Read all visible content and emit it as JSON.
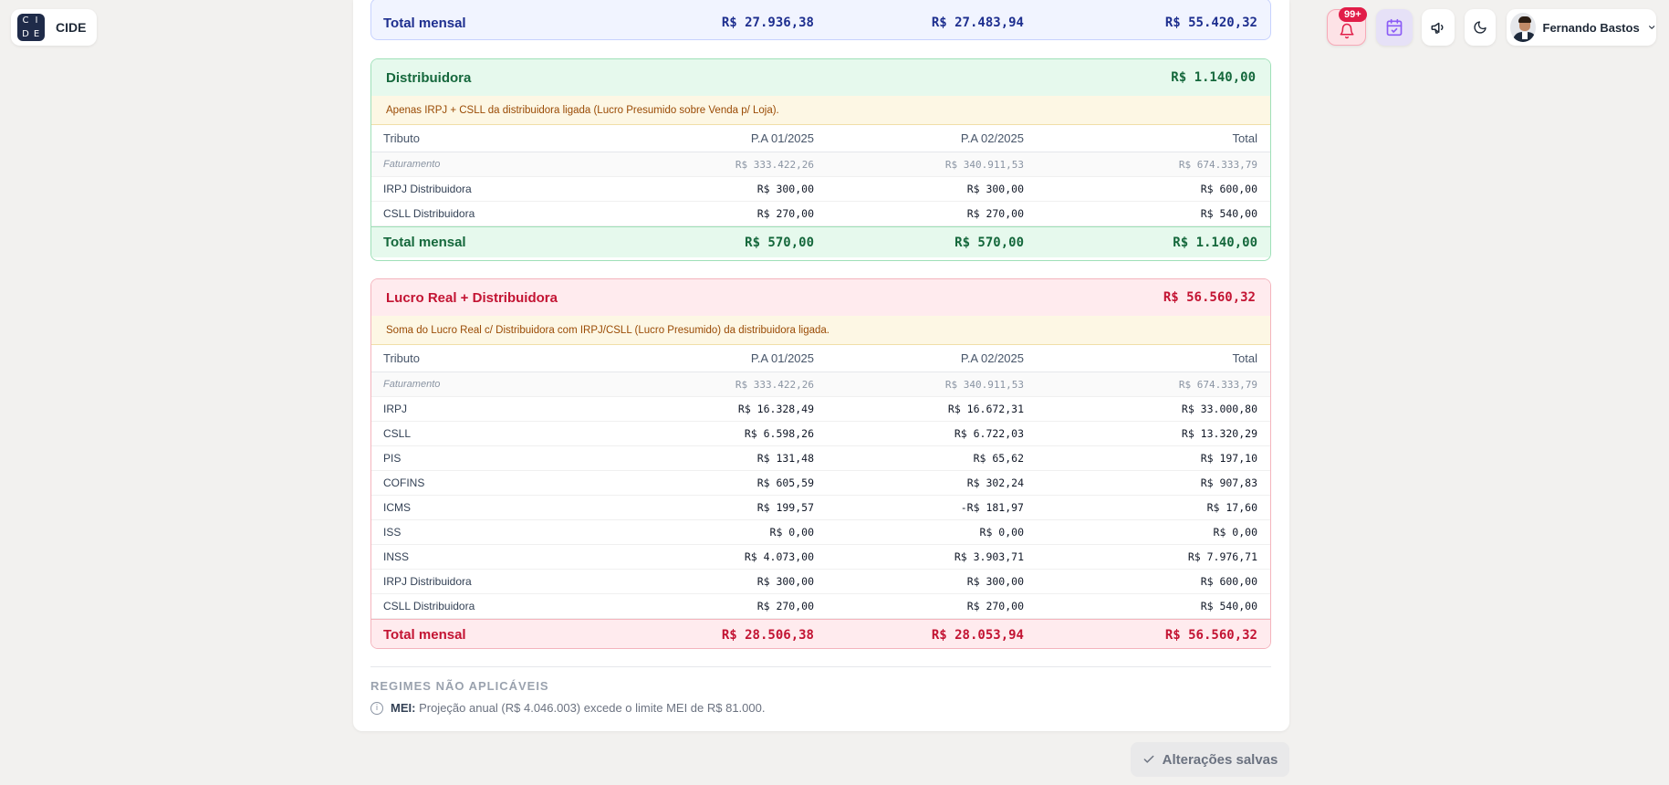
{
  "app": {
    "logo_letters": [
      "C",
      "I",
      "D",
      "E"
    ],
    "name": "CIDE"
  },
  "header": {
    "notifications_badge": "99+",
    "user_name": "Fernando Bastos"
  },
  "columns": {
    "tributo": "Tributo",
    "p1": "P.A 01/2025",
    "p2": "P.A 02/2025",
    "total": "Total"
  },
  "top_total": {
    "label": "Total mensal",
    "p1": "R$ 27.936,38",
    "p2": "R$ 27.483,94",
    "total": "R$ 55.420,32"
  },
  "distribuidora": {
    "title": "Distribuidora",
    "amount": "R$ 1.140,00",
    "note": "Apenas IRPJ + CSLL da distribuidora ligada (Lucro Presumido sobre Venda p/ Loja).",
    "faturamento": {
      "label": "Faturamento",
      "p1": "R$ 333.422,26",
      "p2": "R$ 340.911,53",
      "total": "R$ 674.333,79"
    },
    "rows": [
      {
        "label": "IRPJ Distribuidora",
        "p1": "R$ 300,00",
        "p2": "R$ 300,00",
        "total": "R$ 600,00"
      },
      {
        "label": "CSLL Distribuidora",
        "p1": "R$ 270,00",
        "p2": "R$ 270,00",
        "total": "R$ 540,00"
      }
    ],
    "total": {
      "label": "Total mensal",
      "p1": "R$ 570,00",
      "p2": "R$ 570,00",
      "total": "R$ 1.140,00"
    }
  },
  "lucro_real": {
    "title": "Lucro Real + Distribuidora",
    "amount": "R$ 56.560,32",
    "note": "Soma do Lucro Real c/ Distribuidora com IRPJ/CSLL (Lucro Presumido) da distribuidora ligada.",
    "faturamento": {
      "label": "Faturamento",
      "p1": "R$ 333.422,26",
      "p2": "R$ 340.911,53",
      "total": "R$ 674.333,79"
    },
    "rows": [
      {
        "label": "IRPJ",
        "p1": "R$ 16.328,49",
        "p2": "R$ 16.672,31",
        "total": "R$ 33.000,80"
      },
      {
        "label": "CSLL",
        "p1": "R$ 6.598,26",
        "p2": "R$ 6.722,03",
        "total": "R$ 13.320,29"
      },
      {
        "label": "PIS",
        "p1": "R$ 131,48",
        "p2": "R$ 65,62",
        "total": "R$ 197,10"
      },
      {
        "label": "COFINS",
        "p1": "R$ 605,59",
        "p2": "R$ 302,24",
        "total": "R$ 907,83"
      },
      {
        "label": "ICMS",
        "p1": "R$ 199,57",
        "p2": "-R$ 181,97",
        "total": "R$ 17,60"
      },
      {
        "label": "ISS",
        "p1": "R$ 0,00",
        "p2": "R$ 0,00",
        "total": "R$ 0,00"
      },
      {
        "label": "INSS",
        "p1": "R$ 4.073,00",
        "p2": "R$ 3.903,71",
        "total": "R$ 7.976,71"
      },
      {
        "label": "IRPJ Distribuidora",
        "p1": "R$ 300,00",
        "p2": "R$ 300,00",
        "total": "R$ 600,00"
      },
      {
        "label": "CSLL Distribuidora",
        "p1": "R$ 270,00",
        "p2": "R$ 270,00",
        "total": "R$ 540,00"
      }
    ],
    "total": {
      "label": "Total mensal",
      "p1": "R$ 28.506,38",
      "p2": "R$ 28.053,94",
      "total": "R$ 56.560,32"
    }
  },
  "nao_aplicaveis": {
    "title": "REGIMES NÃO APLICÁVEIS",
    "items": [
      {
        "regime": "MEI:",
        "text": "Projeção anual (R$ 4.046.003) excede o limite MEI de R$ 81.000."
      }
    ]
  },
  "status": {
    "saved_label": "Alterações salvas"
  },
  "colors": {
    "green": "#15683c",
    "red": "#c31433",
    "blue": "#1e2f8f",
    "note_bg": "#fdf7e4"
  }
}
